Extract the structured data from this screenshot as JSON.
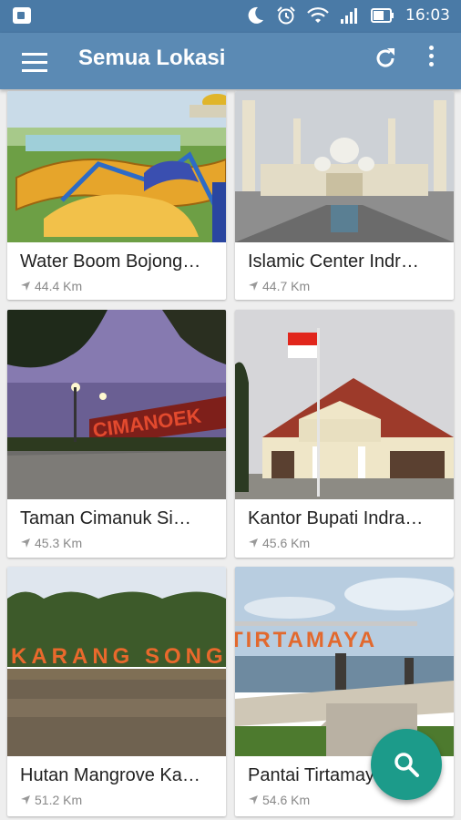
{
  "status_bar": {
    "time": "16:03"
  },
  "app_bar": {
    "title": "Semua Lokasi"
  },
  "locations": [
    {
      "name": "Water Boom Bojong…",
      "distance": "44.4 Km"
    },
    {
      "name": "Islamic Center Indr…",
      "distance": "44.7 Km"
    },
    {
      "name": "Taman Cimanuk Si…",
      "distance": "45.3 Km"
    },
    {
      "name": "Kantor Bupati Indra…",
      "distance": "45.6 Km"
    },
    {
      "name": "Hutan Mangrove Ka…",
      "distance": "51.2 Km"
    },
    {
      "name": "Pantai Tirtamaya",
      "distance": "54.6 Km"
    }
  ],
  "image_signs": {
    "taman": "CIMANOEK",
    "mangrove": "KARANG SONG",
    "pantai": "TIRTAMAYA"
  },
  "colors": {
    "status_bar": "#4a7aa6",
    "app_bar": "#5b8ab4",
    "fab": "#1c9b8a",
    "background": "#eeeeee"
  },
  "icons": {
    "menu": "hamburger-icon",
    "refresh": "refresh-icon",
    "more": "more-vert-icon",
    "fab": "search-icon",
    "distance": "navigation-arrow-icon"
  }
}
